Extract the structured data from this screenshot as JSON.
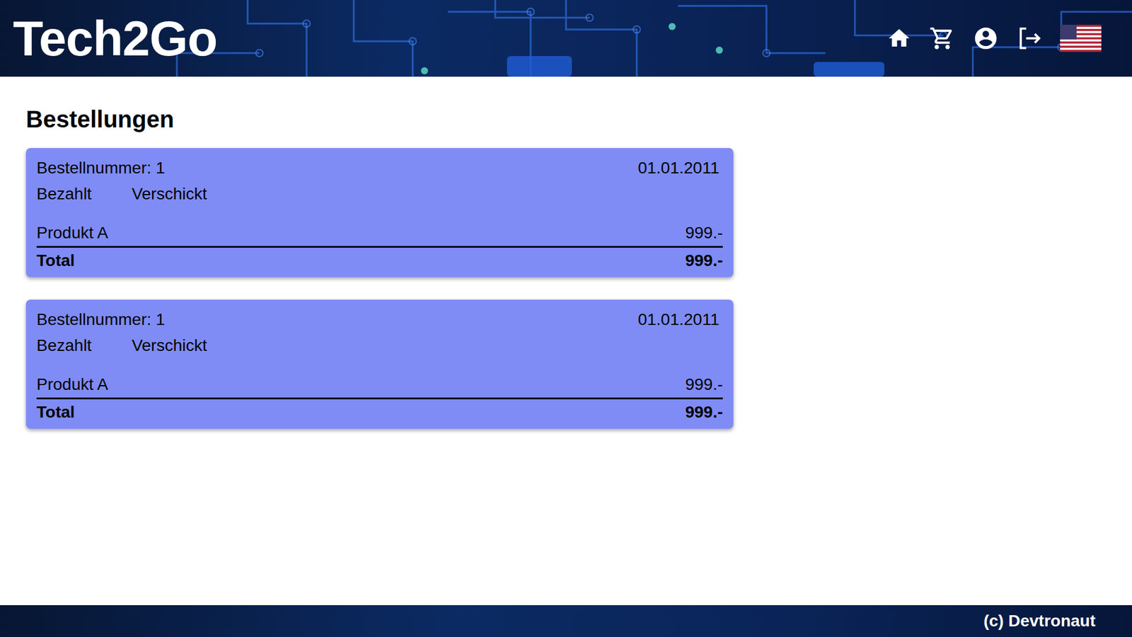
{
  "header": {
    "logo": "Tech2Go"
  },
  "page": {
    "title": "Bestellungen"
  },
  "orders": [
    {
      "number": "Bestellnummer: 1",
      "date": "01.01.2011",
      "statuses": [
        "Bezahlt",
        "Verschickt"
      ],
      "items": [
        {
          "name": "Produkt A",
          "price": "999.-"
        }
      ],
      "total_label": "Total",
      "total": "999.-"
    },
    {
      "number": "Bestellnummer: 1",
      "date": "01.01.2011",
      "statuses": [
        "Bezahlt",
        "Verschickt"
      ],
      "items": [
        {
          "name": "Produkt A",
          "price": "999.-"
        }
      ],
      "total_label": "Total",
      "total": "999.-"
    }
  ],
  "footer": {
    "text": "(c) Devtronaut"
  }
}
